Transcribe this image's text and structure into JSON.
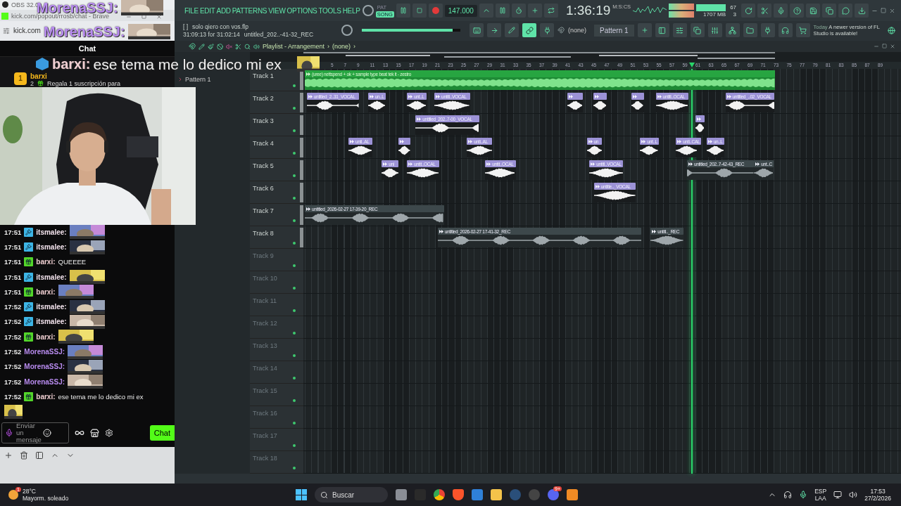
{
  "obs_title": "OBS 32.0",
  "browser": {
    "title": "kick.com/popout/rrosb/chat - Brave",
    "address": "kick.com"
  },
  "overlay_messages": [
    {
      "user": "MorenaSSJ:",
      "color": "#b98cf0",
      "emote": true
    },
    {
      "user": "MorenaSSJ:",
      "color": "#b98cf0",
      "emote": true
    },
    {
      "user": "barxi:",
      "color": "#f0cfd2",
      "text": "ese tema me lo dedico mi ex",
      "emote": true
    }
  ],
  "chat": {
    "title": "Chat",
    "pinned": {
      "rank": "1",
      "user": "barxi",
      "count": "2",
      "text": "Regala 1 suscripción para"
    },
    "messages": [
      {
        "time": "17:51",
        "kind": "mod",
        "user": "itsmalee:",
        "color": "#f4e4ee",
        "emote": true
      },
      {
        "time": "17:51",
        "kind": "mod",
        "user": "itsmalee:",
        "color": "#f4e4ee",
        "emote": true
      },
      {
        "time": "17:51",
        "kind": "sub",
        "user": "barxi:",
        "color": "#f0cfd2",
        "text": "QUEEEE"
      },
      {
        "time": "17:51",
        "kind": "mod",
        "user": "itsmalee:",
        "color": "#f4e4ee",
        "emote": true
      },
      {
        "time": "17:51",
        "kind": "sub",
        "user": "barxi:",
        "color": "#f0cfd2",
        "emote": true
      },
      {
        "time": "17:52",
        "kind": "mod",
        "user": "itsmalee:",
        "color": "#f4e4ee",
        "emote": true
      },
      {
        "time": "17:52",
        "kind": "mod",
        "user": "itsmalee:",
        "color": "#f4e4ee",
        "emote": true
      },
      {
        "time": "17:52",
        "kind": "sub",
        "user": "barxi:",
        "color": "#f0cfd2",
        "emote": true
      },
      {
        "time": "17:52",
        "kind": "plain",
        "user": "MorenaSSJ:",
        "color": "#b98cf0",
        "emote": true
      },
      {
        "time": "17:52",
        "kind": "plain",
        "user": "MorenaSSJ:",
        "color": "#b98cf0",
        "emote": true
      },
      {
        "time": "17:52",
        "kind": "plain",
        "user": "MorenaSSJ:",
        "color": "#b98cf0",
        "emote": true
      },
      {
        "time": "17:52",
        "kind": "sub",
        "user": "barxi:",
        "color": "#f0cfd2",
        "text": "ese tema me lo dedico mi ex",
        "emote_below": true
      }
    ],
    "input": {
      "placeholder": "Enviar un mensaje"
    },
    "send_button": "Chat"
  },
  "fl": {
    "menu": [
      "FILE",
      "EDIT",
      "ADD",
      "PATTERNS",
      "VIEW",
      "OPTIONS",
      "TOOLS",
      "HELP"
    ],
    "mode_pat": "PAT",
    "mode_song": "SONG",
    "song_selected": true,
    "tempo": "147.000",
    "time": "1:36:19",
    "time_unit": "M:S:CS",
    "cpu": "67",
    "memory": "1707 MB",
    "polyphony": "3",
    "project_marker": "[ ]",
    "project": "solo qiero con vos.flp",
    "project_time": "31:09:13 for 31:02:14",
    "hint": "untitled_202..-41-32_REC",
    "master_volume": {
      "level": 0.92
    },
    "snap": "(none)",
    "pattern": "Pattern 1",
    "news": {
      "date": "Today",
      "text": "A newer version of FL Studio is available!"
    }
  },
  "playlist": {
    "title": "Playlist - Arrangement",
    "separators": [
      "›",
      "›"
    ],
    "arrangement": "(none)",
    "patterns": [
      "Pattern 1"
    ],
    "ruler": [
      "5",
      "7",
      "9",
      "11",
      "13",
      "15",
      "17",
      "19",
      "21",
      "23",
      "25",
      "27",
      "29",
      "31",
      "33",
      "35",
      "37",
      "39",
      "41",
      "43",
      "45",
      "47",
      "49",
      "51",
      "53",
      "55",
      "57",
      "59",
      "61",
      "63",
      "65",
      "67",
      "69",
      "71",
      "73",
      "75",
      "77",
      "79",
      "81",
      "83",
      "85",
      "87",
      "89"
    ],
    "tracks": [
      {
        "name": "Track 1",
        "active": true,
        "clips": [
          {
            "kind": "beat",
            "label": "(uree) nettspend + ok + sample type beat tek it - zestro"
          }
        ]
      },
      {
        "name": "Track 2",
        "active": true,
        "clips": [
          {
            "kind": "vocal",
            "label": "untitled_2..31_VOCAL"
          },
          {
            "kind": "vocal",
            "label": "un..L"
          },
          {
            "kind": "vocal",
            "label": "unt..L"
          },
          {
            "kind": "vocal",
            "label": "untitl..VOCAL"
          },
          {
            "kind": "vocal"
          },
          {
            "kind": "vocal"
          },
          {
            "kind": "vocal"
          },
          {
            "kind": "vocal",
            "label": "untitl..OCAL"
          },
          {
            "kind": "vocal",
            "label": "untitled_..02_VOCAL"
          }
        ]
      },
      {
        "name": "Track 3",
        "active": true,
        "clips": [
          {
            "kind": "vocal",
            "label": "untitled_202..7-00_VOCAL"
          },
          {
            "kind": "vocal"
          }
        ]
      },
      {
        "name": "Track 4",
        "active": true,
        "clips": [
          {
            "kind": "vocal",
            "label": "unti..AL"
          },
          {
            "kind": "vocal"
          },
          {
            "kind": "vocal",
            "label": "unti..AL"
          },
          {
            "kind": "vocal",
            "label": "un"
          },
          {
            "kind": "vocal",
            "label": "unt..L"
          },
          {
            "kind": "vocal",
            "label": "unti..CAL"
          },
          {
            "kind": "vocal",
            "label": "un..L"
          }
        ]
      },
      {
        "name": "Track 5",
        "active": true,
        "clips": [
          {
            "kind": "vocal",
            "label": "uni"
          },
          {
            "kind": "vocal",
            "label": "untit..OCAL"
          },
          {
            "kind": "vocal",
            "label": "untit..OCAL"
          },
          {
            "kind": "vocal",
            "label": "untitl..VOCAL"
          },
          {
            "kind": "rec",
            "label": "untitled_202..7-42-43_REC"
          },
          {
            "kind": "rec",
            "label": "unt..C"
          }
        ]
      },
      {
        "name": "Track 6",
        "active": true,
        "clips": [
          {
            "kind": "vocal",
            "label": "untitle.._VOCAL"
          }
        ]
      },
      {
        "name": "Track 7",
        "active": true,
        "clips": [
          {
            "kind": "rec",
            "label": "untitled_2026-02-27 17-39-20_REC"
          }
        ]
      },
      {
        "name": "Track 8",
        "active": true,
        "clips": [
          {
            "kind": "rec",
            "label": "untitled_2026-02-27 17-41-32_REC"
          },
          {
            "kind": "rec",
            "label": "untitl.._REC"
          }
        ]
      },
      {
        "name": "Track 9",
        "active": false
      },
      {
        "name": "Track 10",
        "active": false
      },
      {
        "name": "Track 11",
        "active": false
      },
      {
        "name": "Track 12",
        "active": false
      },
      {
        "name": "Track 13",
        "active": false
      },
      {
        "name": "Track 14",
        "active": false
      },
      {
        "name": "Track 15",
        "active": false
      },
      {
        "name": "Track 16",
        "active": false
      },
      {
        "name": "Track 17",
        "active": false
      },
      {
        "name": "Track 18",
        "active": false
      }
    ]
  },
  "taskbar": {
    "weather_badge": "1",
    "temperature": "28°C",
    "weather": "Mayorm. soleado",
    "search": "Buscar",
    "discord_badge": "9+",
    "lang": "ESP",
    "layout": "LAA",
    "time": "17:53",
    "date": "27/2/2026"
  }
}
